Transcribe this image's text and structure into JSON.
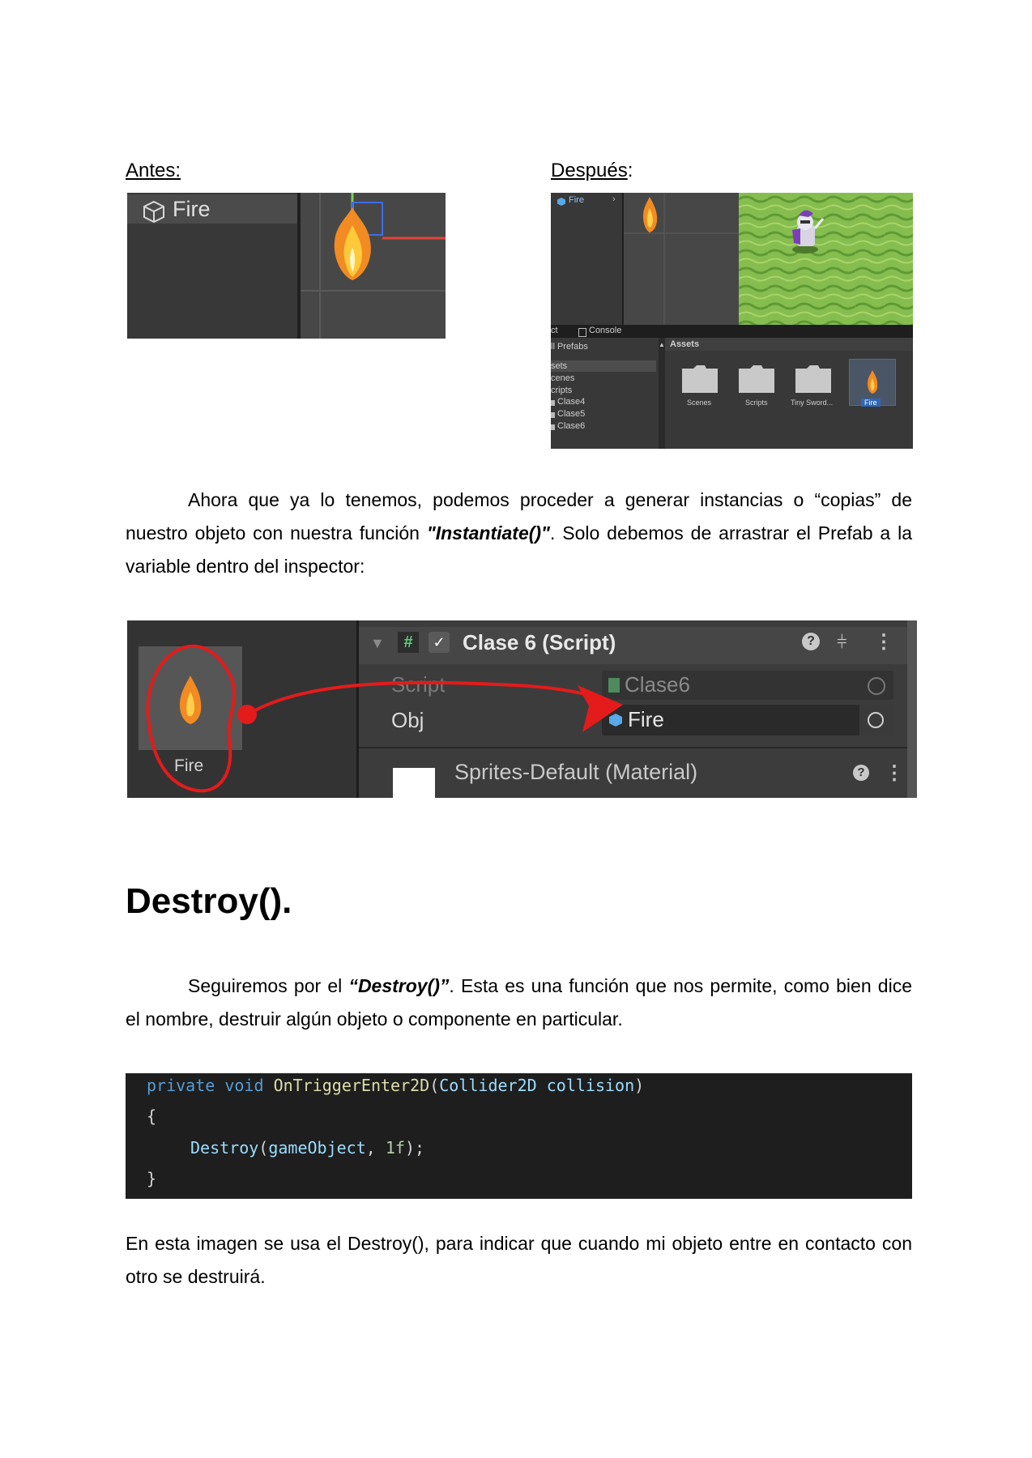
{
  "before_label": "Antes:",
  "after_label_word": "Después",
  "after_label_colon": ":",
  "before_shot": {
    "object_name": "Fire"
  },
  "after_shot": {
    "hierarchy_item": "Fire",
    "console_tab": "Console",
    "project_tab_fragment": "ct",
    "all_prefabs": "ll Prefabs",
    "assets_header": "Assets",
    "tree": [
      "sets",
      "cenes",
      "cripts",
      "Clase4",
      "Clase5",
      "Clase6"
    ],
    "folders": [
      "Scenes",
      "Scripts",
      "Tiny Sword..."
    ],
    "selected_asset": "Fire"
  },
  "paragraph1": {
    "before": "Ahora que ya lo tenemos, podemos proceder a generar instancias o “copias” de nuestro objeto con nuestra función ",
    "emphasis": "\"Instantiate()\"",
    "after": ". Solo debemos de arrastrar el Prefab a la variable dentro del inspector:"
  },
  "inspector": {
    "prefab_label": "Fire",
    "component_title": "Clase 6 (Script)",
    "script_label": "Script",
    "script_value": "Clase6",
    "obj_label": "Obj",
    "obj_value": "Fire",
    "material": "Sprites-Default (Material)"
  },
  "heading": "Destroy().",
  "paragraph2": {
    "before": "Seguiremos por el ",
    "emphasis": "“Destroy()”",
    "after": ". Esta es una función que nos permite, como bien dice el nombre, destruir algún objeto o componente en particular."
  },
  "code": {
    "kw1": "private",
    "kw2": "void",
    "method": "OnTriggerEnter2D",
    "param_type": "Collider2D",
    "param_name": "collision",
    "open_brace": "{",
    "call": "Destroy",
    "arg1": "gameObject",
    "arg2": "1f",
    "close_brace": "}"
  },
  "paragraph3": "En esta imagen se usa el Destroy(), para indicar que cuando mi objeto entre en contacto con otro se destruirá."
}
